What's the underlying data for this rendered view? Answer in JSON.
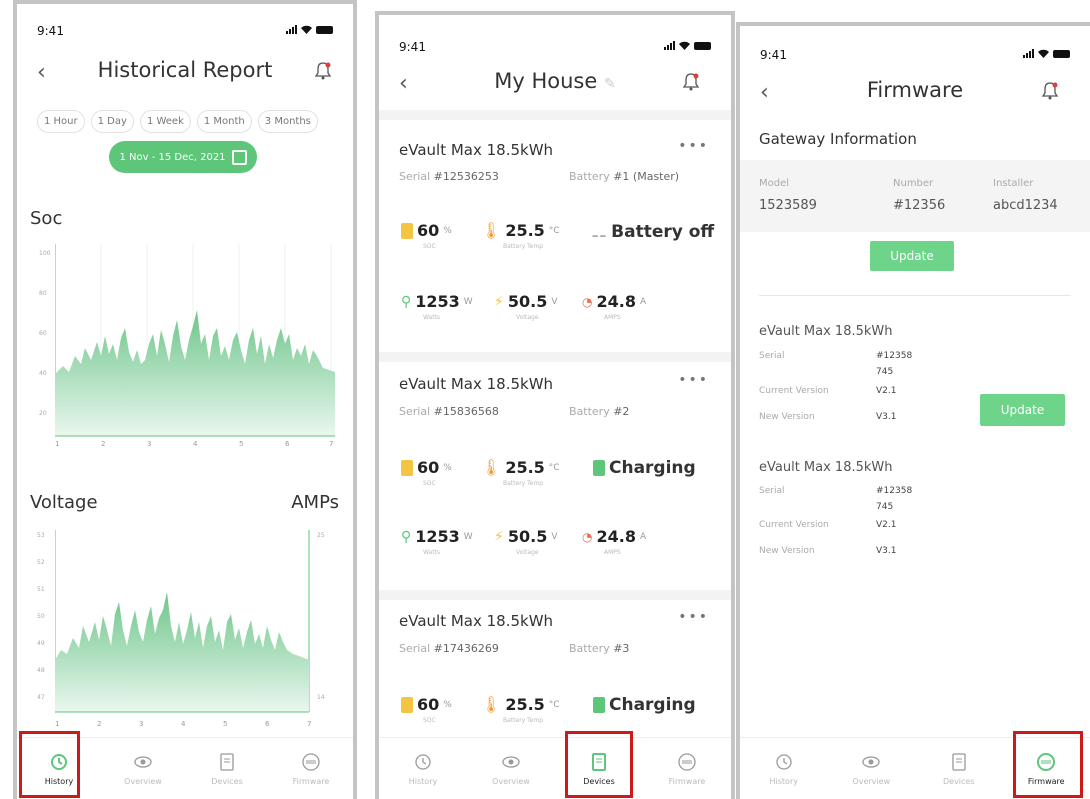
{
  "status": {
    "time": "9:41"
  },
  "screen1": {
    "title": "Historical Report",
    "tabs": [
      "1 Hour",
      "1 Day",
      "1 Week",
      "1 Month",
      "3 Months"
    ],
    "date_range": "1 Nov - 15 Dec, 2021",
    "soc": {
      "title": "Soc",
      "yticks": [
        "100",
        "80",
        "60",
        "40",
        "20"
      ],
      "xticks": [
        "1",
        "2",
        "3",
        "4",
        "5",
        "6",
        "7"
      ]
    },
    "voltage": {
      "title_left": "Voltage",
      "title_right": "AMPs",
      "yticks_left": [
        "53",
        "52",
        "51",
        "50",
        "49",
        "48",
        "47"
      ],
      "ytick_right_top": "25",
      "ytick_right_bottom": "14",
      "xticks": [
        "1",
        "2",
        "3",
        "4",
        "5",
        "6",
        "7"
      ]
    }
  },
  "screen2": {
    "title": "My House",
    "devices": [
      {
        "name": "eVault Max 18.5kWh",
        "serial_label": "Serial",
        "serial": "#12536253",
        "battery_label": "Battery",
        "battery": "#1 (Master)",
        "soc": "60",
        "soc_unit": "%",
        "soc_cap": "SOC",
        "temp": "25.5",
        "temp_unit": "°C",
        "temp_cap": "Battery Temp",
        "status": "Battery off",
        "watts": "1253",
        "watts_unit": "W",
        "watts_cap": "Watts",
        "volts": "50.5",
        "volts_unit": "V",
        "volts_cap": "Voltage",
        "amps": "24.8",
        "amps_unit": "A",
        "amps_cap": "AMPS"
      },
      {
        "name": "eVault Max 18.5kWh",
        "serial_label": "Serial",
        "serial": "#15836568",
        "battery_label": "Battery",
        "battery": "#2",
        "soc": "60",
        "soc_unit": "%",
        "soc_cap": "SOC",
        "temp": "25.5",
        "temp_unit": "°C",
        "temp_cap": "Battery Temp",
        "status": "Charging",
        "watts": "1253",
        "watts_unit": "W",
        "watts_cap": "Watts",
        "volts": "50.5",
        "volts_unit": "V",
        "volts_cap": "Voltage",
        "amps": "24.8",
        "amps_unit": "A",
        "amps_cap": "AMPS"
      },
      {
        "name": "eVault Max 18.5kWh",
        "serial_label": "Serial",
        "serial": "#17436269",
        "battery_label": "Battery",
        "battery": "#3",
        "soc": "60",
        "soc_unit": "%",
        "soc_cap": "SOC",
        "temp": "25.5",
        "temp_unit": "°C",
        "temp_cap": "Battery Temp",
        "status": "Charging"
      }
    ]
  },
  "screen3": {
    "title": "Firmware",
    "gateway_title": "Gateway Information",
    "model_label": "Model",
    "model": "1523589",
    "number_label": "Number",
    "number": "#12356",
    "installer_label": "Installer",
    "installer": "abcd1234",
    "update_label": "Update",
    "devices": [
      {
        "name": "eVault Max 18.5kWh",
        "serial_label": "Serial",
        "serial_1": "#12358",
        "serial_2": "745",
        "current_label": "Current Version",
        "current": "V2.1",
        "new_label": "New Version",
        "new": "V3.1"
      },
      {
        "name": "eVault Max 18.5kWh",
        "serial_label": "Serial",
        "serial_1": "#12358",
        "serial_2": "745",
        "current_label": "Current Version",
        "current": "V2.1",
        "new_label": "New Version",
        "new": "V3.1"
      }
    ]
  },
  "nav": {
    "history": "History",
    "overview": "Overview",
    "devices": "Devices",
    "firmware": "Firmware"
  },
  "colors": {
    "accent": "#5dc679",
    "chart_fill": "#a8dcb8",
    "highlight": "#cd1b1b"
  },
  "chart_data": [
    {
      "type": "area",
      "title": "Soc",
      "x": [
        1,
        2,
        3,
        4,
        5,
        6,
        7
      ],
      "ylim": [
        0,
        100
      ],
      "grid": true
    },
    {
      "type": "area",
      "title": "Voltage",
      "x": [
        1,
        2,
        3,
        4,
        5,
        6,
        7
      ],
      "ylim": [
        47,
        53
      ],
      "y2label": "AMPs",
      "y2lim": [
        14,
        25
      ],
      "grid": true
    }
  ]
}
